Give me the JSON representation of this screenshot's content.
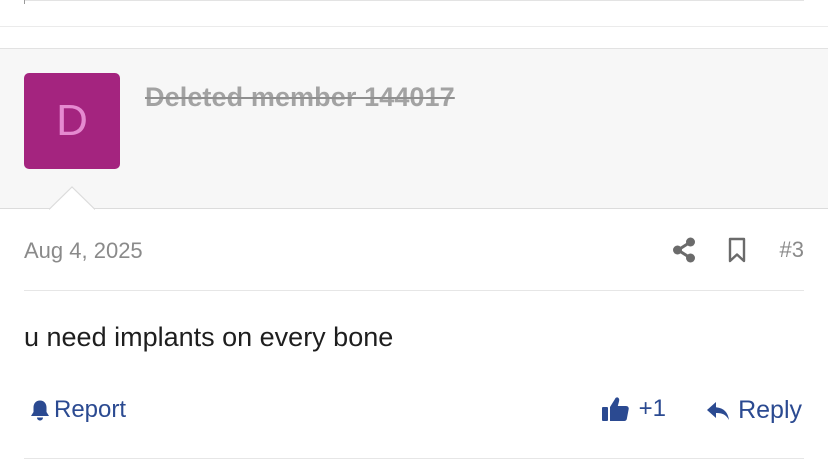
{
  "post": {
    "author": {
      "avatar_letter": "D",
      "name": "Deleted member 144017",
      "avatar_bg": "#a4247f",
      "avatar_fg": "#e58ad0"
    },
    "date": "Aug 4, 2025",
    "number": "#3",
    "body": "u need implants on every bone",
    "actions": {
      "report_label": "Report",
      "reaction_count": "+1",
      "reply_label": "Reply"
    },
    "icons": {
      "share": "share-icon",
      "bookmark": "bookmark-icon",
      "report": "bell-icon",
      "reaction": "thumbs-up-icon",
      "reply": "reply-icon"
    }
  },
  "colors": {
    "link": "#2b4a91",
    "muted": "#8a8a8a",
    "header_bg": "#f7f7f7"
  }
}
